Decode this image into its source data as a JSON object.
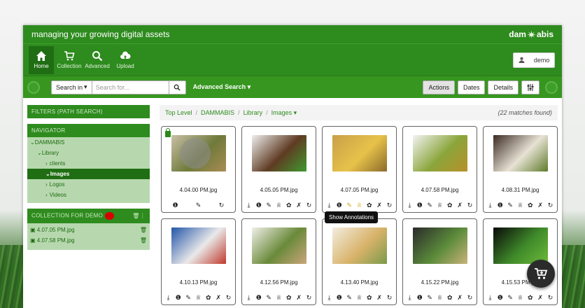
{
  "header": {
    "tagline": "managing your growing digital assets",
    "brand_left": "dam",
    "brand_right": "abis"
  },
  "nav": {
    "items": [
      {
        "label": "Home",
        "icon": "home-icon"
      },
      {
        "label": "Collection",
        "icon": "cart-icon"
      },
      {
        "label": "Advanced",
        "icon": "search-icon"
      },
      {
        "label": "Upload",
        "icon": "cloud-upload-icon"
      }
    ],
    "user": "demo"
  },
  "search": {
    "scope_label": "Search in",
    "placeholder": "Search for...",
    "advanced_label": "Advanced Search"
  },
  "toolbar": {
    "actions": "Actions",
    "dates": "Dates",
    "details": "Details"
  },
  "sidebar": {
    "filters_title": "FILTERS (PATH SEARCH)",
    "navigator_title": "NAVIGATOR",
    "tree": [
      {
        "label": "DAMMABIS",
        "prefix": "⌄"
      },
      {
        "label": "Library",
        "prefix": "⌄"
      },
      {
        "label": "clients",
        "prefix": "›"
      },
      {
        "label": "Images",
        "prefix": "⌄",
        "selected": true
      },
      {
        "label": "Logos",
        "prefix": "›"
      },
      {
        "label": "Videos",
        "prefix": "›"
      }
    ],
    "collection_title": "COLLECTION FOR DEMO",
    "collection_items": [
      "4.07.05 PM.jpg",
      "4.07.58 PM.jpg"
    ]
  },
  "breadcrumb": {
    "items": [
      "Top Level",
      "DAMMABIS",
      "Library",
      "Images"
    ],
    "matches": "(22 matches found)"
  },
  "assets": [
    {
      "name": "4.04.00 PM.jpg",
      "colors": [
        "#c9c0a6",
        "#6f7a3a",
        "#a98c54"
      ],
      "locked": true
    },
    {
      "name": "4.05.05 PM.jpg",
      "colors": [
        "#efefef",
        "#5f3b22",
        "#3f9a2f"
      ]
    },
    {
      "name": "4.07.05 PM.jpg",
      "colors": [
        "#c8a04a",
        "#e7c24a",
        "#8a6a2a"
      ]
    },
    {
      "name": "4.07.58 PM.jpg",
      "colors": [
        "#f3f3f3",
        "#8aa53a",
        "#b8902a"
      ]
    },
    {
      "name": "4.08.31 PM.jpg",
      "colors": [
        "#3b2a22",
        "#e7e2d4",
        "#5f7a2a"
      ]
    },
    {
      "name": "4.10.13 PM.jpg",
      "colors": [
        "#2255a8",
        "#e9e9e9",
        "#c0392b"
      ]
    },
    {
      "name": "4.12.56 PM.jpg",
      "colors": [
        "#f0efe8",
        "#6a8a3a",
        "#c9a57a"
      ]
    },
    {
      "name": "4.13.40 PM.jpg",
      "colors": [
        "#f2ede0",
        "#d9b36a",
        "#7a9a4a"
      ]
    },
    {
      "name": "4.15.22 PM.jpg",
      "colors": [
        "#2b2b2b",
        "#5a8a3a",
        "#c9b27a"
      ]
    },
    {
      "name": "4.15.53 PM.jpg",
      "colors": [
        "#0a0a0a",
        "#3f8a2a",
        "#6fba3a"
      ]
    }
  ],
  "tooltip": "Show Annotations"
}
